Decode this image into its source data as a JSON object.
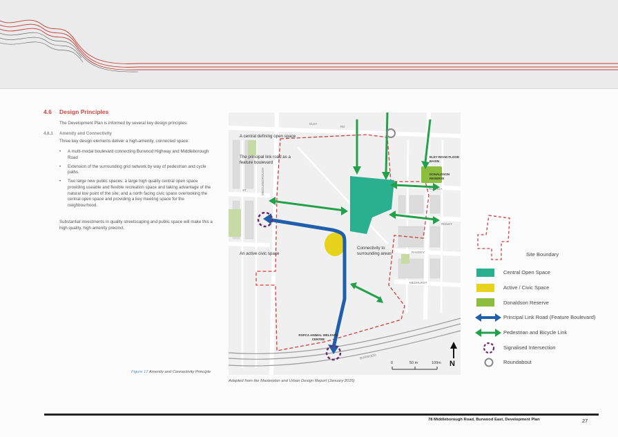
{
  "section": {
    "number": "4.6",
    "title": "Design Principles",
    "intro": "The Development Plan is informed by several key design principles:"
  },
  "subsection": {
    "number": "4.6.1",
    "title": "Amenity and Connectivity",
    "body": "Three key design elements deliver a high-amenity, connected space:",
    "bullets": [
      "A multi-modal boulevard connecting Burwood Highway and Middleborough Road",
      "Extension of the surrounding grid network by way of pedestrian and cycle paths.",
      "Two large new public spaces: a large high quality central open space providing useable and flexible recreation space and taking advantage of the natural low point of the site; and a north facing civic space overlooking the central open space and providing a key meeting space for the neighbourhood."
    ],
    "closing": "Substantial investments in quality streetscaping and public space will make this a high quality, high amenity precinct."
  },
  "figure": {
    "label": "Figure 17",
    "caption": "Amenity and Connectivity Principle",
    "source": "Adapted from the Masterplan and Urban Design Report (January 2015)"
  },
  "map": {
    "annotations": {
      "central_open_space": "A central defining open space",
      "link_road": "The principal link road as a feature boulevard",
      "civic_space": "An active civic space",
      "connectivity": "Connectivity to surrounding areas"
    },
    "places": {
      "flood_basin": "ELEY ROAD FLOOD BASIN",
      "donaldson": "DONALDSON RESERVE",
      "rspca": "RSPCA ANIMAL WELFARE CENTRE"
    },
    "streets": {
      "eley": "ELEY",
      "rd": "RD",
      "burwood": "BURWOOD",
      "ramsey": "RAMSEY",
      "medhurst": "MEDHURST",
      "ridley": "RIDLEY",
      "rochda": "ROCHDA",
      "st": "ST",
      "middleborough": "MIDDLEBOROUGH"
    },
    "scale": [
      "0",
      "50 m",
      "100m"
    ],
    "north": "N"
  },
  "legend": [
    {
      "label": "Site Boundary",
      "icon": "dashed-outline-icon"
    },
    {
      "label": "Central Open Space",
      "icon": "teal-swatch-icon",
      "color": "#2bb08f"
    },
    {
      "label": "Active / Civic Space",
      "icon": "yellow-swatch-icon",
      "color": "#e7d21c"
    },
    {
      "label": "Donaldson Reserve",
      "icon": "green-swatch-icon",
      "color": "#8cbd3f"
    },
    {
      "label": "Principal Link Road (Feature Boulevard)",
      "icon": "blue-double-arrow-icon",
      "color": "#1f5fab"
    },
    {
      "label": "Pedestrian and Bicycle Link",
      "icon": "green-double-arrow-icon",
      "color": "#23a04a"
    },
    {
      "label": "Signalised Intersection",
      "icon": "dashed-circle-icon",
      "color": "#6b2b6e"
    },
    {
      "label": "Roundabout",
      "icon": "circle-icon",
      "color": "#888888"
    }
  ],
  "colors": {
    "heading": "#d1453b",
    "site_boundary": "#d23c3c",
    "central_open_space": "#2bb08f",
    "civic_space": "#e7d21c",
    "reserve": "#8cbd3f",
    "link_road": "#1f5fab",
    "ped_link": "#23a04a",
    "signal": "#6b2b6e"
  },
  "footer": {
    "title": "78 Middleborough Road, Burwood East, Development Plan",
    "page": "27"
  }
}
